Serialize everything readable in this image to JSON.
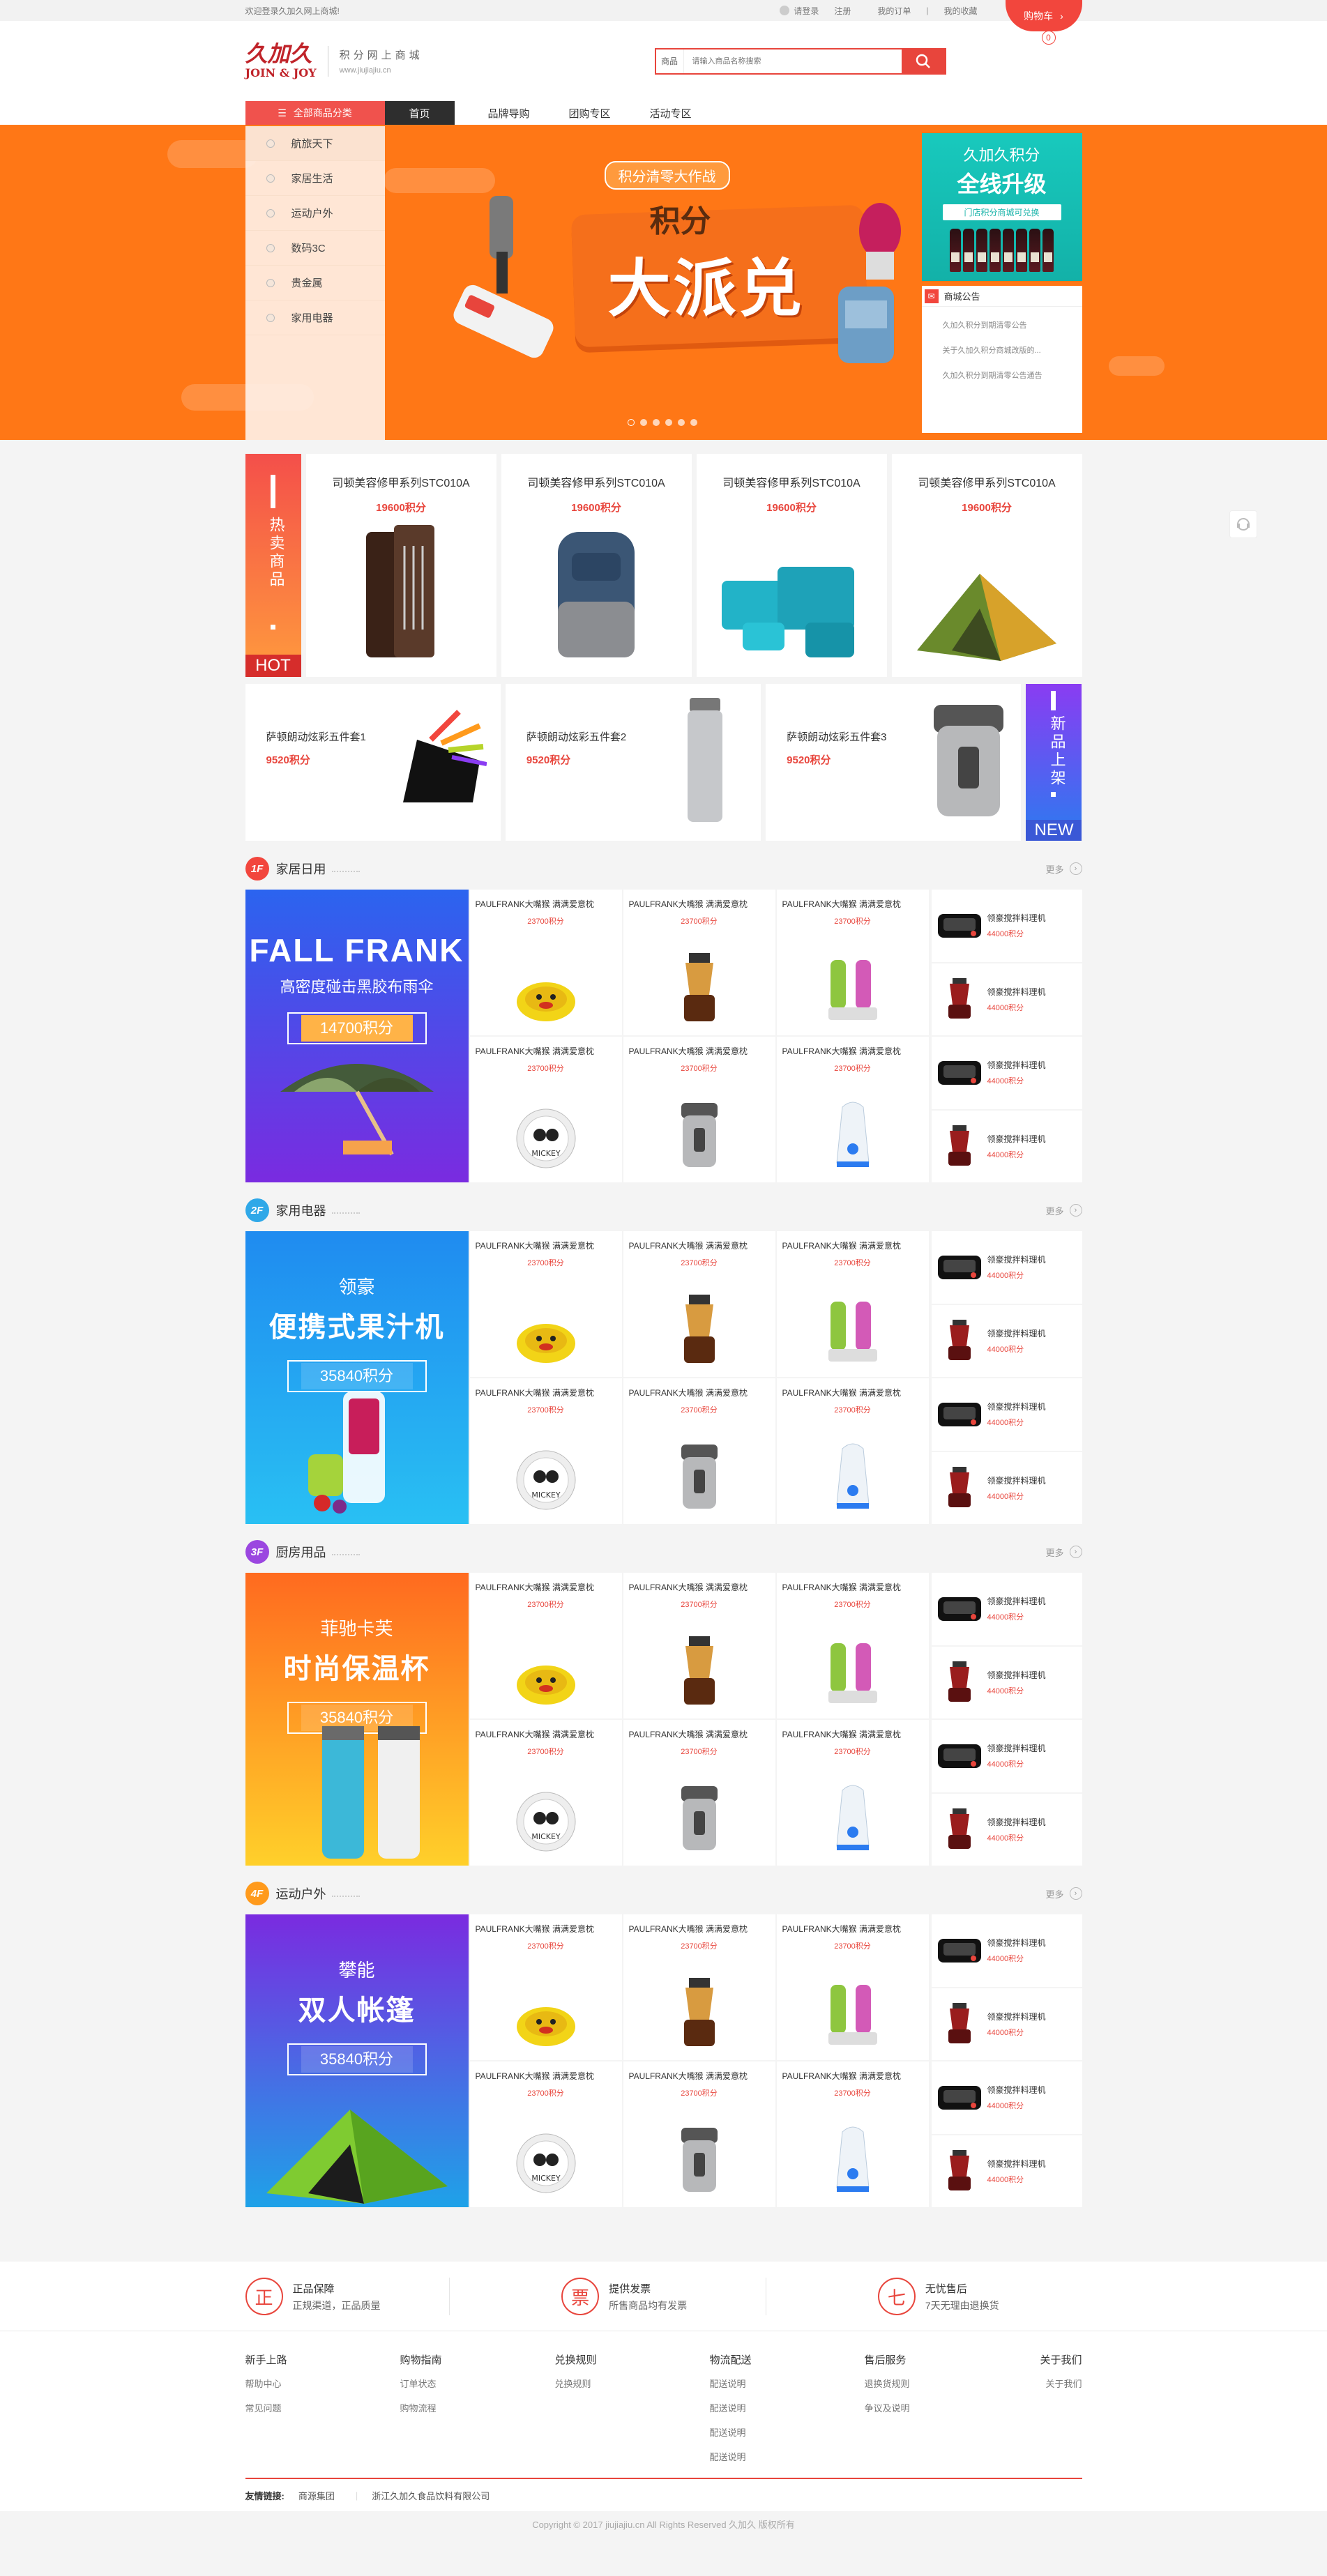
{
  "topbar": {
    "welcome": "欢迎登录久加久网上商城!",
    "login": "请登录",
    "register": "注册",
    "my_orders": "我的订单",
    "my_favorites": "我的收藏",
    "cart": "购物车",
    "cart_count": "0"
  },
  "header": {
    "logo_cn": "久加久",
    "logo_en": "JOIN & JOY",
    "tagline": "积分网上商城",
    "url": "www.jiujiajiu.cn",
    "search_category": "商品",
    "search_placeholder": "请输入商品名称搜索"
  },
  "nav": {
    "all_categories": "全部商品分类",
    "items": [
      "首页",
      "品牌导购",
      "团购专区",
      "活动专区"
    ]
  },
  "banner": {
    "categories": [
      "航旅天下",
      "家居生活",
      "运动户外",
      "数码3C",
      "贵金属",
      "家用电器"
    ],
    "slogan_sub": "积分清零大作战",
    "slogan_top": "积分",
    "slogan_main": "大派兑",
    "slides": 6,
    "active_slide": 1,
    "upgrade_line1": "久加久积分",
    "upgrade_line2": "全线升级",
    "upgrade_line3": "门店积分商城可兑换",
    "notice_title": "商城公告",
    "notices": [
      "久加久积分到期清零公告",
      "关于久加久积分商城改版的...",
      "久加久积分到期清零公告通告"
    ]
  },
  "hot": {
    "label": "热卖商品",
    "label_en": "HOT",
    "items": [
      {
        "name": "司顿美容修甲系列STC010A",
        "price": "19600积分"
      },
      {
        "name": "司顿美容修甲系列STC010A",
        "price": "19600积分"
      },
      {
        "name": "司顿美容修甲系列STC010A",
        "price": "19600积分"
      },
      {
        "name": "司顿美容修甲系列STC010A",
        "price": "19600积分"
      }
    ]
  },
  "new": {
    "label": "新品上架",
    "label_en": "NEW",
    "items": [
      {
        "name": "萨顿朗动炫彩五件套1",
        "price": "9520积分"
      },
      {
        "name": "萨顿朗动炫彩五件套2",
        "price": "9520积分"
      },
      {
        "name": "萨顿朗动炫彩五件套3",
        "price": "9520积分"
      }
    ]
  },
  "floors": [
    {
      "num": "1F",
      "title": "家居日用",
      "color": "#f2463d",
      "more": "更多",
      "banner_line1": "FALL FRANK",
      "banner_line2": "高密度碰击黑胶布雨伞",
      "banner_price": "14700积分"
    },
    {
      "num": "2F",
      "title": "家用电器",
      "color": "#2fa8e8",
      "more": "更多",
      "banner_line1": "领豪",
      "banner_line2": "便携式果汁机",
      "banner_price": "35840积分"
    },
    {
      "num": "3F",
      "title": "厨房用品",
      "color": "#9b46e0",
      "more": "更多",
      "banner_line1": "菲驰卡芙",
      "banner_line2": "时尚保温杯",
      "banner_price": "35840积分"
    },
    {
      "num": "4F",
      "title": "运动户外",
      "color": "#ff9a1c",
      "more": "更多",
      "banner_line1": "攀能",
      "banner_line2": "双人帐篷",
      "banner_price": "35840积分"
    }
  ],
  "grid_item": {
    "name": "PAULFRANK大嘴猴 满满爱意枕",
    "price": "23700积分"
  },
  "side_item": {
    "name": "领豪搅拌料理机",
    "price": "44000积分"
  },
  "service": [
    {
      "icon": "正",
      "title": "正品保障",
      "desc": "正规渠道，正品质量"
    },
    {
      "icon": "票",
      "title": "提供发票",
      "desc": "所售商品均有发票"
    },
    {
      "icon": "七",
      "title": "无忧售后",
      "desc": "7天无理由退换货"
    }
  ],
  "footer_cols": [
    {
      "title": "新手上路",
      "links": [
        "帮助中心",
        "常见问题"
      ]
    },
    {
      "title": "购物指南",
      "links": [
        "订单状态",
        "购物流程"
      ]
    },
    {
      "title": "兑换规则",
      "links": [
        "兑换规则"
      ]
    },
    {
      "title": "物流配送",
      "links": [
        "配送说明",
        "配送说明",
        "配送说明",
        "配送说明"
      ]
    },
    {
      "title": "售后服务",
      "links": [
        "退换货规则",
        "争议及说明"
      ]
    },
    {
      "title": "关于我们",
      "links": [
        "关于我们"
      ]
    }
  ],
  "friend_links": {
    "label": "友情链接:",
    "items": [
      "商源集团",
      "浙江久加久食品饮料有限公司"
    ]
  },
  "copyright": "Copyright © 2017 jiujiajiu.cn All Rights Reserved 久加久 版权所有"
}
